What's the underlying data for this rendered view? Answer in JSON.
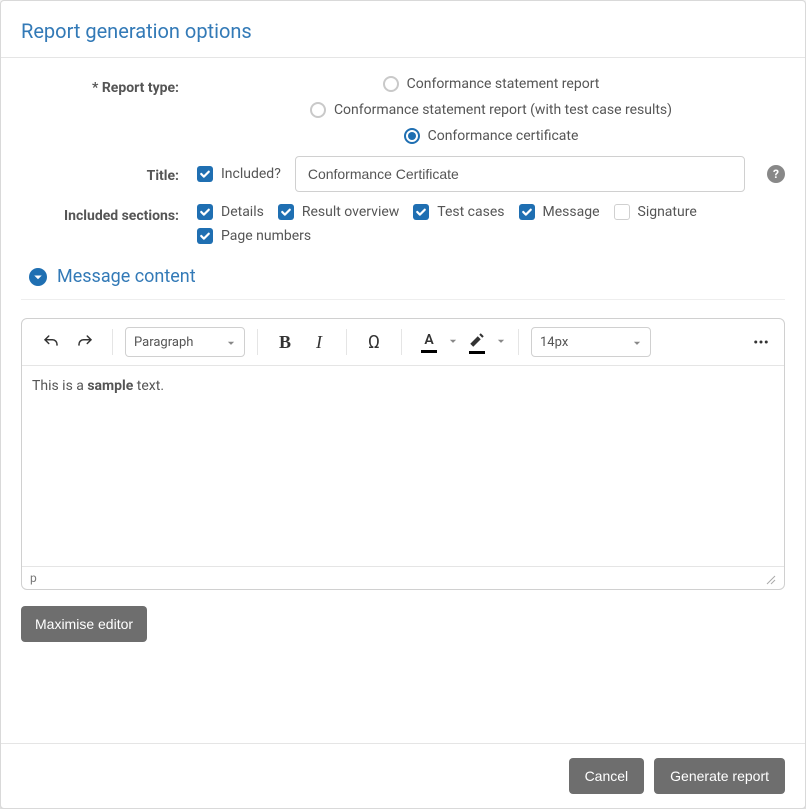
{
  "header": {
    "title": "Report generation options"
  },
  "form": {
    "reportType": {
      "label": "* Report type:",
      "options": [
        {
          "label": "Conformance statement report",
          "checked": false
        },
        {
          "label": "Conformance statement report (with test case results)",
          "checked": false
        },
        {
          "label": "Conformance certificate",
          "checked": true
        }
      ]
    },
    "title": {
      "label": "Title:",
      "includedLabel": "Included?",
      "includedChecked": true,
      "value": "Conformance Certificate"
    },
    "sections": {
      "label": "Included sections:",
      "items": [
        {
          "label": "Details",
          "checked": true
        },
        {
          "label": "Result overview",
          "checked": true
        },
        {
          "label": "Test cases",
          "checked": true
        },
        {
          "label": "Message",
          "checked": true
        },
        {
          "label": "Signature",
          "checked": false
        },
        {
          "label": "Page numbers",
          "checked": true
        }
      ]
    }
  },
  "messageSection": {
    "title": "Message content"
  },
  "editor": {
    "paragraphSelect": "Paragraph",
    "fontSizeSelect": "14px",
    "content_prefix": "This is a ",
    "content_bold": "sample",
    "content_suffix": " text.",
    "footerPath": "p"
  },
  "buttons": {
    "maximize": "Maximise editor",
    "cancel": "Cancel",
    "generate": "Generate report"
  }
}
